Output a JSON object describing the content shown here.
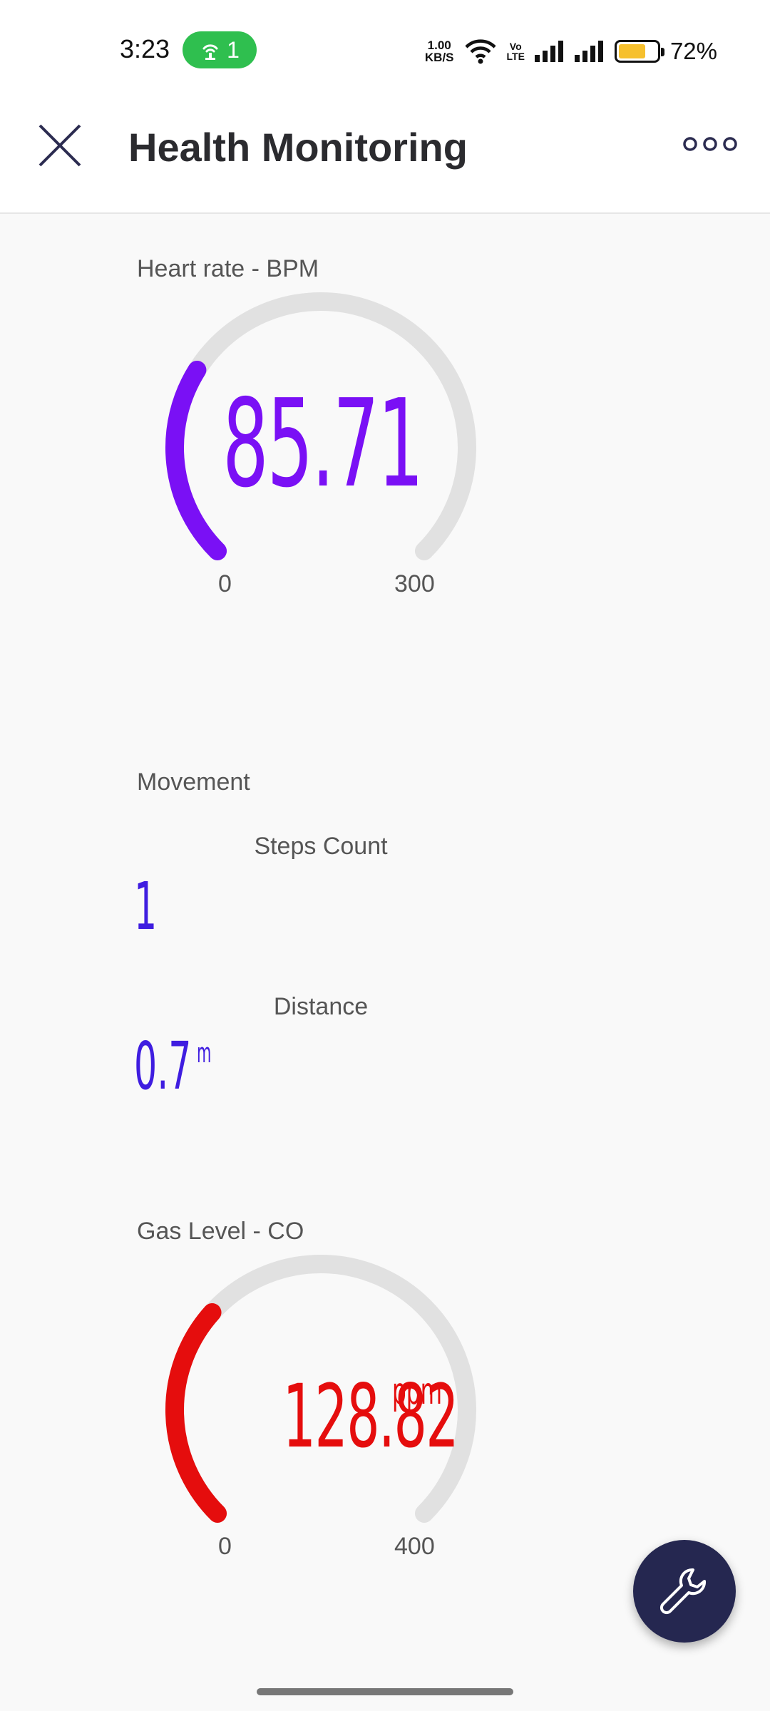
{
  "status_bar": {
    "time": "3:23",
    "hotspot_count": "1",
    "net_speed_value": "1.00",
    "net_speed_unit": "KB/S",
    "volte_top": "Vo",
    "volte_bottom": "LTE",
    "battery_percent": "72%",
    "battery_level": 0.72
  },
  "app_bar": {
    "title": "Health Monitoring",
    "close_icon": "close-icon",
    "more_icon": "more-horizontal-icon"
  },
  "heart_rate": {
    "label": "Heart rate - BPM",
    "value": "85.71",
    "min": "0",
    "max": "300",
    "numeric_value": 85.71,
    "color": "#7a10f5"
  },
  "movement": {
    "label": "Movement",
    "steps_title": "Steps Count",
    "steps_value": "1",
    "distance_title": "Distance",
    "distance_value": "0.7",
    "distance_unit": "m",
    "color": "#3f1de0"
  },
  "gas_level": {
    "label": "Gas Level - CO",
    "value": "128.82",
    "unit": "ppm",
    "min": "0",
    "max": "400",
    "numeric_value": 128.82,
    "color": "#e50d0d"
  },
  "fab": {
    "icon": "wrench-icon"
  }
}
